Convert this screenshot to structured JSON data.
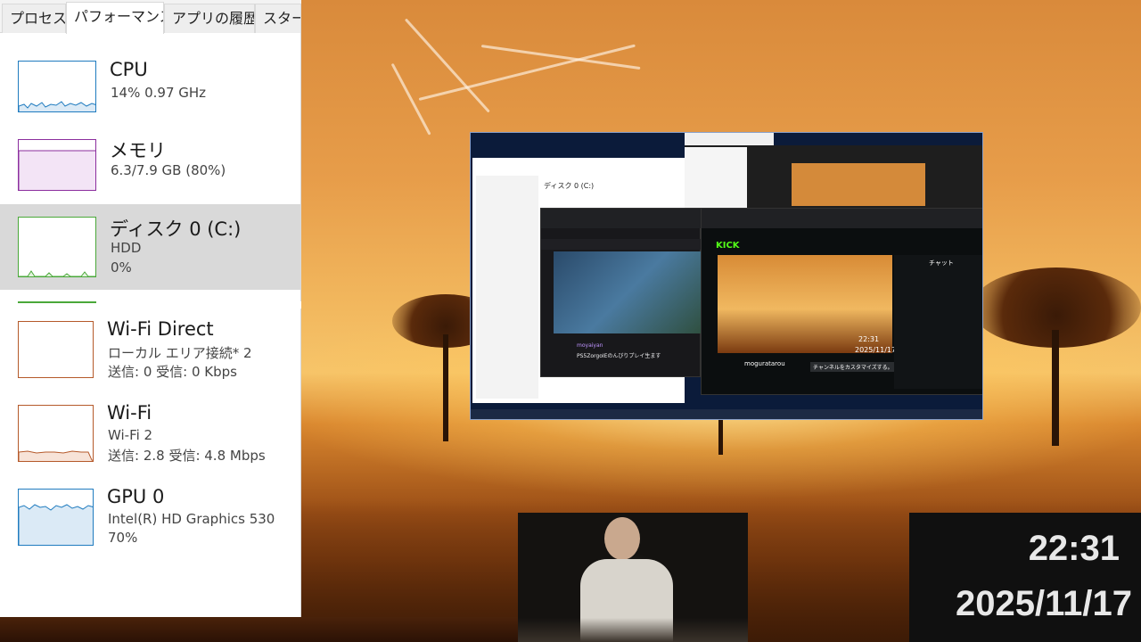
{
  "taskmanager": {
    "tabs": [
      "プロセス",
      "パフォーマンス",
      "アプリの履歴",
      "スタートアップ"
    ],
    "active_tab": "パフォーマンス",
    "items": [
      {
        "title": "CPU",
        "line1": "14%  0.97 GHz",
        "line2": "",
        "graph_color": "#1f7bbf",
        "usage_percent": 14
      },
      {
        "title": "メモリ",
        "line1": "6.3/7.9 GB (80%)",
        "line2": "",
        "graph_color": "#8b2e9e",
        "usage_percent": 80
      },
      {
        "title": "ディスク 0 (C:)",
        "line1": "HDD",
        "line2": "0%",
        "graph_color": "#4aa839",
        "usage_percent": 0
      },
      {
        "title": "Wi-Fi Direct",
        "line1": "ローカル エリア接続* 2",
        "line2": "送信: 0  受信: 0 Kbps",
        "graph_color": "#b5592a",
        "usage_percent": 0
      },
      {
        "title": "Wi-Fi",
        "line1": "Wi-Fi 2",
        "line2": "送信: 2.8  受信: 4.8 Mbps",
        "graph_color": "#b5592a"
      },
      {
        "title": "GPU 0",
        "line1": "Intel(R) HD Graphics 530",
        "line2": "70%",
        "graph_color": "#1f7bbf",
        "usage_percent": 70
      }
    ]
  },
  "capture": {
    "kick_logo": "KICK",
    "channel": "moguratarou",
    "customize_button": "チャンネルをカスタマイズする。",
    "chat_title": "チャット",
    "clock_time": "22:31",
    "clock_date": "2025/11/17",
    "stream_title": "PS5ZorgoIEのんびりプレイ生ます",
    "streamer": "moyaiyan"
  },
  "overlay": {
    "time": "22:31",
    "date": "2025/11/17"
  }
}
